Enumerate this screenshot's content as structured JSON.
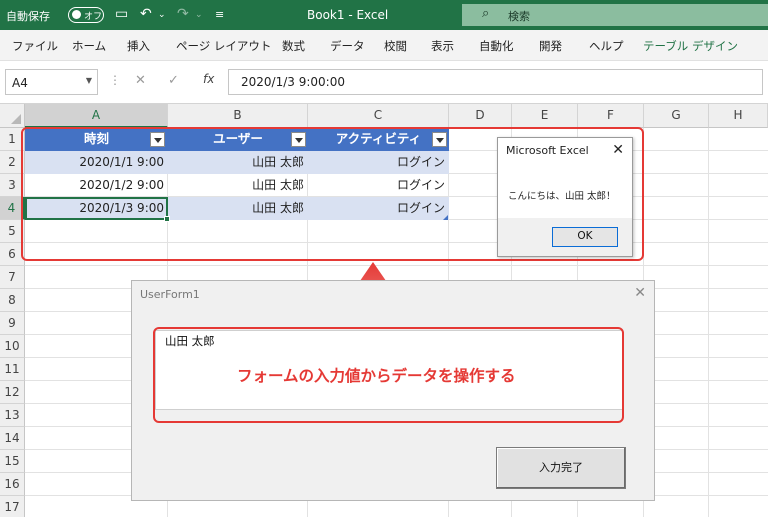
{
  "titlebar": {
    "autosave_label": "自動保存",
    "autosave_state": "オフ",
    "doc_title": "Book1  -  Excel",
    "search_label": "検索",
    "icons": [
      "save-icon",
      "undo-icon",
      "redo-icon",
      "customize-icon"
    ]
  },
  "ribbon": {
    "tabs": [
      "ファイル",
      "ホーム",
      "挿入",
      "ページ レイアウト",
      "数式",
      "データ",
      "校閲",
      "表示",
      "自動化",
      "開発",
      "ヘルプ",
      "テーブル デザイン"
    ]
  },
  "formula_bar": {
    "name_box": "A4",
    "cancel_glyph": "✕",
    "enter_glyph": "✓",
    "fx_label": "fx",
    "content": "2020/1/3  9:00:00"
  },
  "grid": {
    "columns": [
      "A",
      "B",
      "C",
      "D",
      "E",
      "F",
      "G",
      "H"
    ],
    "rows": [
      "1",
      "2",
      "3",
      "4",
      "5",
      "6",
      "7",
      "8",
      "9",
      "10",
      "11",
      "12",
      "13",
      "14",
      "15",
      "16",
      "17"
    ],
    "selected_cell": "A4"
  },
  "table": {
    "headers": [
      "時刻",
      "ユーザー",
      "アクティビティ"
    ],
    "rows": [
      [
        "2020/1/1 9:00",
        "山田 太郎",
        "ログイン"
      ],
      [
        "2020/1/2 9:00",
        "山田 太郎",
        "ログイン"
      ],
      [
        "2020/1/3 9:00",
        "山田 太郎",
        "ログイン"
      ]
    ],
    "header_color": "#4472c4",
    "band_color": "#d9e1f2"
  },
  "msgbox": {
    "title": "Microsoft Excel",
    "message": "こんにちは、山田 太郎！",
    "ok_label": "OK"
  },
  "userform": {
    "title": "UserForm1",
    "text_value": "山田 太郎",
    "button_label": "入力完了"
  },
  "annotation": {
    "text": "フォームの入力値からデータを操作する",
    "color": "#e53935"
  }
}
